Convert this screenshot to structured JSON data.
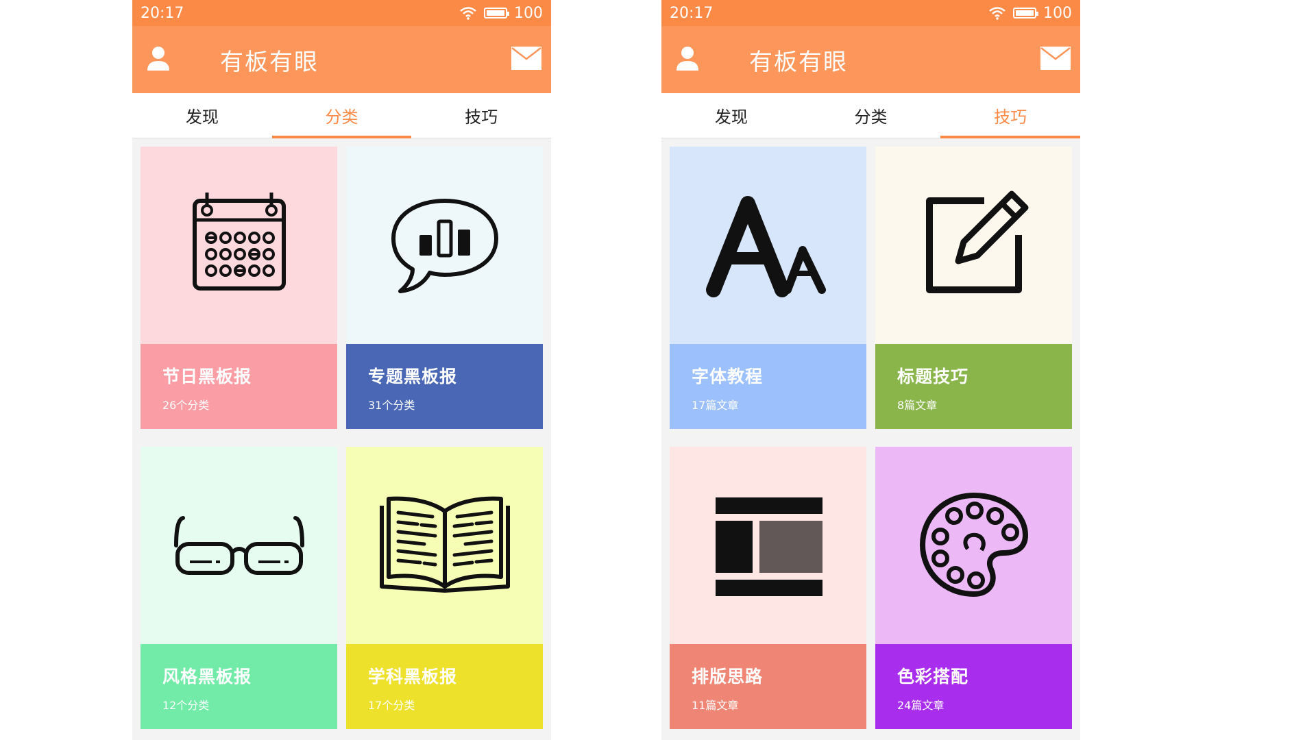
{
  "phones": [
    {
      "status": {
        "time": "20:17",
        "battery": "100"
      },
      "app_title": "有板有眼",
      "tabs": [
        "发现",
        "分类",
        "技巧"
      ],
      "active_tab": 1,
      "cards": [
        {
          "name": "节日黑板报",
          "count": "26个分类",
          "icon": "calendar-icon",
          "bg_top": "#fdd8dc",
          "bg_bottom": "#fb9da4"
        },
        {
          "name": "专题黑板报",
          "count": "31个分类",
          "icon": "chat-bar-chart-icon",
          "bg_top": "#eef8fa",
          "bg_bottom": "#4a67b6"
        },
        {
          "name": "风格黑板报",
          "count": "12个分类",
          "icon": "glasses-icon",
          "bg_top": "#e6fcf1",
          "bg_bottom": "#72eba8"
        },
        {
          "name": "学科黑板报",
          "count": "17个分类",
          "icon": "open-book-icon",
          "bg_top": "#f6fdb5",
          "bg_bottom": "#ede12c"
        }
      ]
    },
    {
      "status": {
        "time": "20:17",
        "battery": "100"
      },
      "app_title": "有板有眼",
      "tabs": [
        "发现",
        "分类",
        "技巧"
      ],
      "active_tab": 2,
      "cards": [
        {
          "name": "字体教程",
          "count": "17篇文章",
          "icon": "font-icon",
          "bg_top": "#d7e6fb",
          "bg_bottom": "#9bc0fb"
        },
        {
          "name": "标题技巧",
          "count": "8篇文章",
          "icon": "edit-icon",
          "bg_top": "#fdf8ed",
          "bg_bottom": "#8ab54b"
        },
        {
          "name": "排版思路",
          "count": "11篇文章",
          "icon": "layout-icon",
          "bg_top": "#fde6e3",
          "bg_bottom": "#ee8575"
        },
        {
          "name": "色彩搭配",
          "count": "24篇文章",
          "icon": "palette-icon",
          "bg_top": "#edb8f6",
          "bg_bottom": "#a92ded"
        }
      ]
    }
  ]
}
